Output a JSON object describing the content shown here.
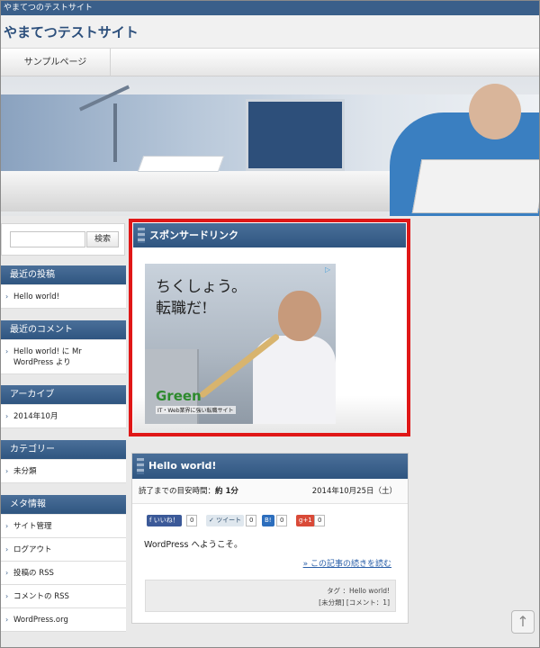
{
  "topbar": {
    "text": "やまてつのテストサイト"
  },
  "header": {
    "site_title": "やまてつテストサイト"
  },
  "nav": {
    "items": [
      "サンプルページ"
    ]
  },
  "sidebar": {
    "search": {
      "placeholder": "",
      "button_label": "検索"
    },
    "sections": [
      {
        "heading": "最近の投稿",
        "items": [
          "Hello world!"
        ]
      },
      {
        "heading": "最近のコメント",
        "items": [
          "Hello world! に Mr WordPress より"
        ]
      },
      {
        "heading": "アーカイブ",
        "items": [
          "2014年10月"
        ]
      },
      {
        "heading": "カテゴリー",
        "items": [
          "未分類"
        ]
      },
      {
        "heading": "メタ情報",
        "items": [
          "サイト管理",
          "ログアウト",
          "投稿の RSS",
          "コメントの RSS",
          "WordPress.org"
        ]
      }
    ]
  },
  "ad": {
    "heading": "スポンサードリンク",
    "headline_line1": "ちくしょう。",
    "headline_line2": "転職だ!",
    "logo": "Green",
    "logo_sub": "IT・Web業界に強い転職サイト",
    "choices_icon": "ad-choices-icon"
  },
  "post": {
    "title": "Hello world!",
    "read_time_label": "読了までの目安時間：",
    "read_time_value": "約 1分",
    "date": "2014年10月25日（土）",
    "share": {
      "like_label": "いいね！",
      "like_count": "0",
      "tweet_label": "ツイート",
      "tweet_count": "0",
      "hatena_label": "B!",
      "hatena_count": "0",
      "gplus_label": "g+1",
      "gplus_count": "0"
    },
    "body": "WordPress へようこそ。",
    "more_link": "» この記事の続きを読む",
    "tags_line": "タグ ：Hello world!",
    "category_line": "[未分類] [コメント：1]"
  },
  "colors": {
    "accent": "#2f5580",
    "highlight": "#e01717",
    "link": "#2a5fa8"
  }
}
